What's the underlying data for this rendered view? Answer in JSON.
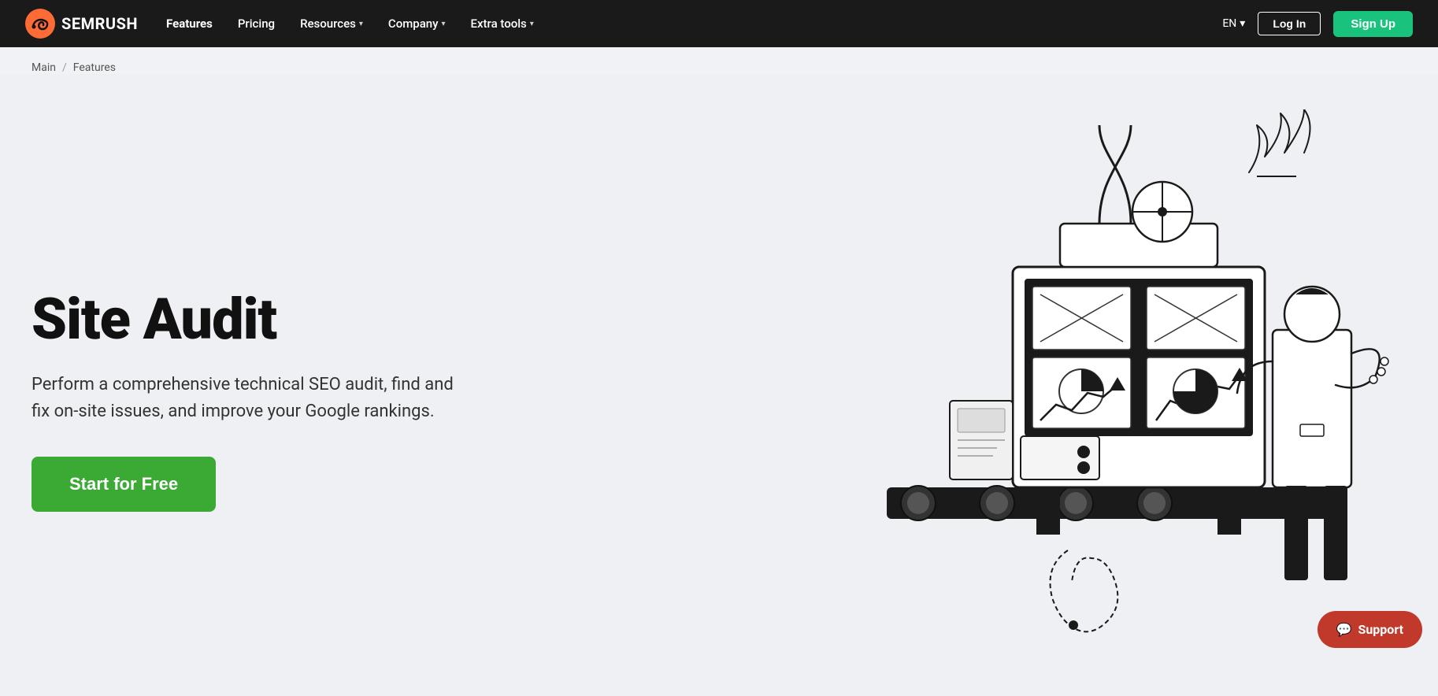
{
  "brand": {
    "name": "SEMRUSH",
    "logo_alt": "Semrush logo"
  },
  "navbar": {
    "links": [
      {
        "label": "Features",
        "active": true,
        "has_dropdown": false
      },
      {
        "label": "Pricing",
        "active": false,
        "has_dropdown": false
      },
      {
        "label": "Resources",
        "active": false,
        "has_dropdown": true
      },
      {
        "label": "Company",
        "active": false,
        "has_dropdown": true
      },
      {
        "label": "Extra tools",
        "active": false,
        "has_dropdown": true
      }
    ],
    "lang": "EN",
    "login_label": "Log In",
    "signup_label": "Sign Up"
  },
  "breadcrumb": {
    "home": "Main",
    "separator": "/",
    "current": "Features"
  },
  "hero": {
    "title": "Site Audit",
    "description": "Perform a comprehensive technical SEO audit, find and fix on-site issues, and improve your Google rankings.",
    "cta_label": "Start for Free"
  },
  "support": {
    "label": "Support"
  }
}
